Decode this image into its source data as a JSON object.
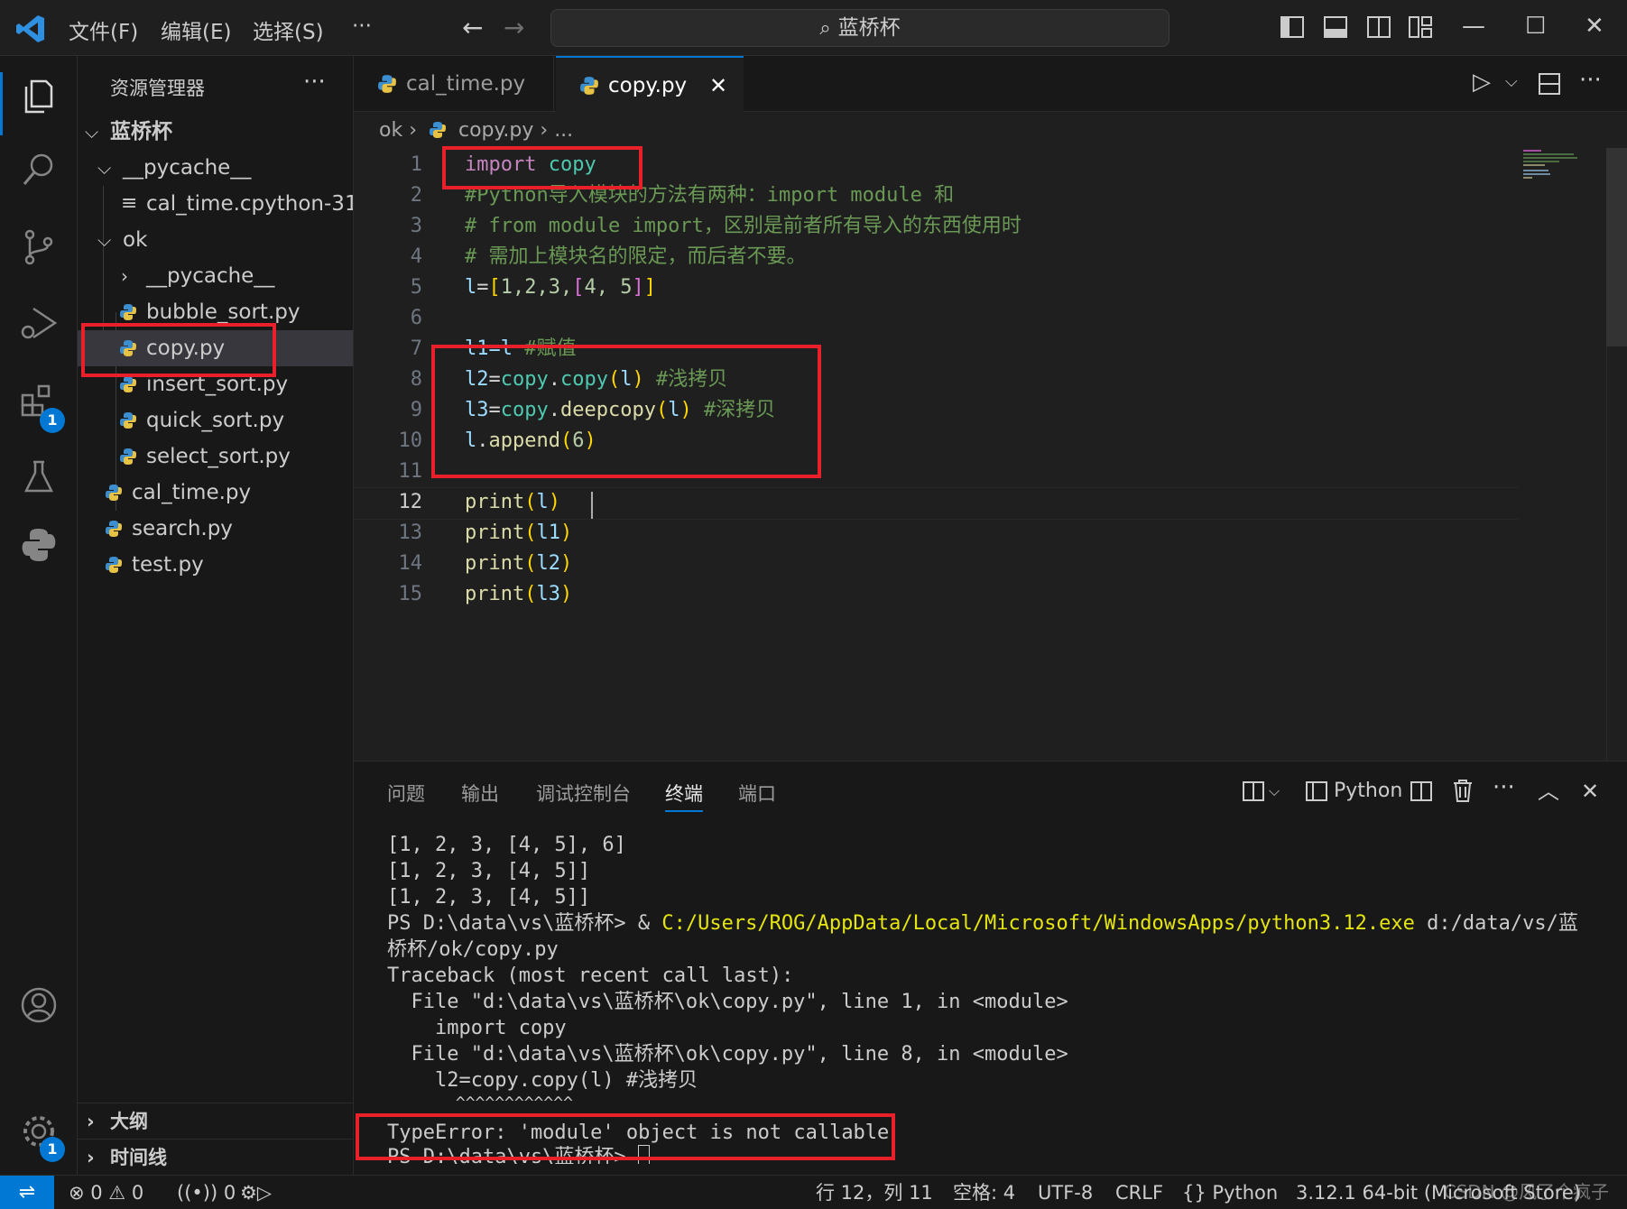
{
  "titlebar": {
    "menus": [
      "文件(F)",
      "编辑(E)",
      "选择(S)",
      "···"
    ],
    "search_text": "蓝桥杯",
    "window_controls": [
      "minimize",
      "maximize",
      "close"
    ]
  },
  "activitybar": {
    "items": [
      "explorer-icon",
      "search-icon",
      "source-control-icon",
      "run-debug-icon",
      "extensions-icon",
      "testing-icon",
      "python-icon"
    ],
    "extensions_badge": "1",
    "settings_badge": "1"
  },
  "sidebar": {
    "title": "资源管理器",
    "more": "···",
    "root": "蓝桥杯",
    "tree": [
      {
        "label": "__pycache__",
        "type": "folder-open"
      },
      {
        "label": "cal_time.cpython-31...",
        "type": "file-text"
      },
      {
        "label": "ok",
        "type": "folder-open"
      },
      {
        "label": "__pycache__",
        "type": "folder-closed"
      },
      {
        "label": "bubble_sort.py",
        "type": "python"
      },
      {
        "label": "copy.py",
        "type": "python",
        "selected": true
      },
      {
        "label": "insert_sort.py",
        "type": "python"
      },
      {
        "label": "quick_sort.py",
        "type": "python"
      },
      {
        "label": "select_sort.py",
        "type": "python"
      },
      {
        "label": "cal_time.py",
        "type": "python"
      },
      {
        "label": "search.py",
        "type": "python"
      },
      {
        "label": "test.py",
        "type": "python"
      }
    ],
    "outline": "大纲",
    "timeline": "时间线"
  },
  "editor": {
    "tabs": [
      {
        "label": "cal_time.py",
        "active": false
      },
      {
        "label": "copy.py",
        "active": true
      }
    ],
    "breadcrumb": {
      "folder": "ok",
      "file": "copy.py",
      "tail": "..."
    },
    "line_numbers": [
      "1",
      "2",
      "3",
      "4",
      "5",
      "6",
      "7",
      "8",
      "9",
      "10",
      "11",
      "12",
      "13",
      "14",
      "15"
    ],
    "current_line": "12",
    "code": {
      "l1_kw": "import",
      "l1_mod": "copy",
      "l2": "#Python导入模块的方法有两种：import module 和",
      "l3": "# from module import，区别是前者所有导入的东西使用时",
      "l4": "# 需加上模块名的限定，而后者不要。",
      "l5_var": "l",
      "l5_eq": "=",
      "l5_open": "[",
      "l5_nums": "1,2,3,",
      "l5_inner_open": "[",
      "l5_inner": "4, 5",
      "l5_inner_close": "]",
      "l5_close": "]",
      "l7_code": "l1=l ",
      "l7_cmt": "#赋值",
      "l8_var": "l2",
      "l8_eq": "=",
      "l8_mod": "copy",
      "l8_dot": ".",
      "l8_fn": "copy",
      "l8_open": "(",
      "l8_arg": "l",
      "l8_close": ")",
      "l8_cmt": " #浅拷贝",
      "l9_var": "l3",
      "l9_eq": "=",
      "l9_mod": "copy",
      "l9_dot": ".",
      "l9_fn": "deepcopy",
      "l9_open": "(",
      "l9_arg": "l",
      "l9_close": ")",
      "l9_cmt": " #深拷贝",
      "l10_var": "l",
      "l10_dot": ".",
      "l10_fn": "append",
      "l10_open": "(",
      "l10_num": "6",
      "l10_close": ")",
      "l12_fn": "print",
      "l12_open": "(",
      "l12_arg": "l",
      "l12_close": ")",
      "l13_fn": "print",
      "l13_open": "(",
      "l13_arg": "l1",
      "l13_close": ")",
      "l14_fn": "print",
      "l14_open": "(",
      "l14_arg": "l2",
      "l14_close": ")",
      "l15_fn": "print",
      "l15_open": "(",
      "l15_arg": "l3",
      "l15_close": ")"
    }
  },
  "panel": {
    "tabs": [
      "问题",
      "输出",
      "调试控制台",
      "终端",
      "端口"
    ],
    "active_tab": "终端",
    "terminal_label": "Python",
    "terminal": {
      "out1": "[1, 2, 3, [4, 5], 6]",
      "out2": "[1, 2, 3, [4, 5]]",
      "out3": "[1, 2, 3, [4, 5]]",
      "cmd_prompt": "PS D:\\data\\vs\\蓝桥杯> & ",
      "cmd_exe": "C:/Users/ROG/AppData/Local/Microsoft/WindowsApps/python3.12.exe",
      "cmd_arg1": " d:/data/vs/蓝",
      "cmd_arg2": "桥杯/ok/copy.py",
      "tb1": "Traceback (most recent call last):",
      "tb2": "  File \"d:\\data\\vs\\蓝桥杯\\ok\\copy.py\", line 1, in <module>",
      "tb3": "    import copy",
      "tb4": "  File \"d:\\data\\vs\\蓝桥杯\\ok\\copy.py\", line 8, in <module>",
      "tb5": "    l2=copy.copy(l) #浅拷贝",
      "tb6": "       ^^^^^^^^^^^^",
      "error": "TypeError: 'module' object is not callable",
      "prompt_final": "PS D:\\data\\vs\\蓝桥杯> "
    }
  },
  "statusbar": {
    "errors": "0",
    "warnings": "0",
    "ports": "0",
    "position": "行 12，列 11",
    "spaces": "空格: 4",
    "encoding": "UTF-8",
    "eol": "CRLF",
    "language": "Python",
    "interpreter": "3.12.1 64-bit (Microsoft Store)",
    "watermark": "CSDN @风了个疯子"
  },
  "colors": {
    "accent": "#0078d4",
    "highlight_box": "#e8202a",
    "keyword": "#c586c0",
    "module": "#4ec9b0",
    "function": "#dcdcaa",
    "comment": "#6a9955"
  }
}
